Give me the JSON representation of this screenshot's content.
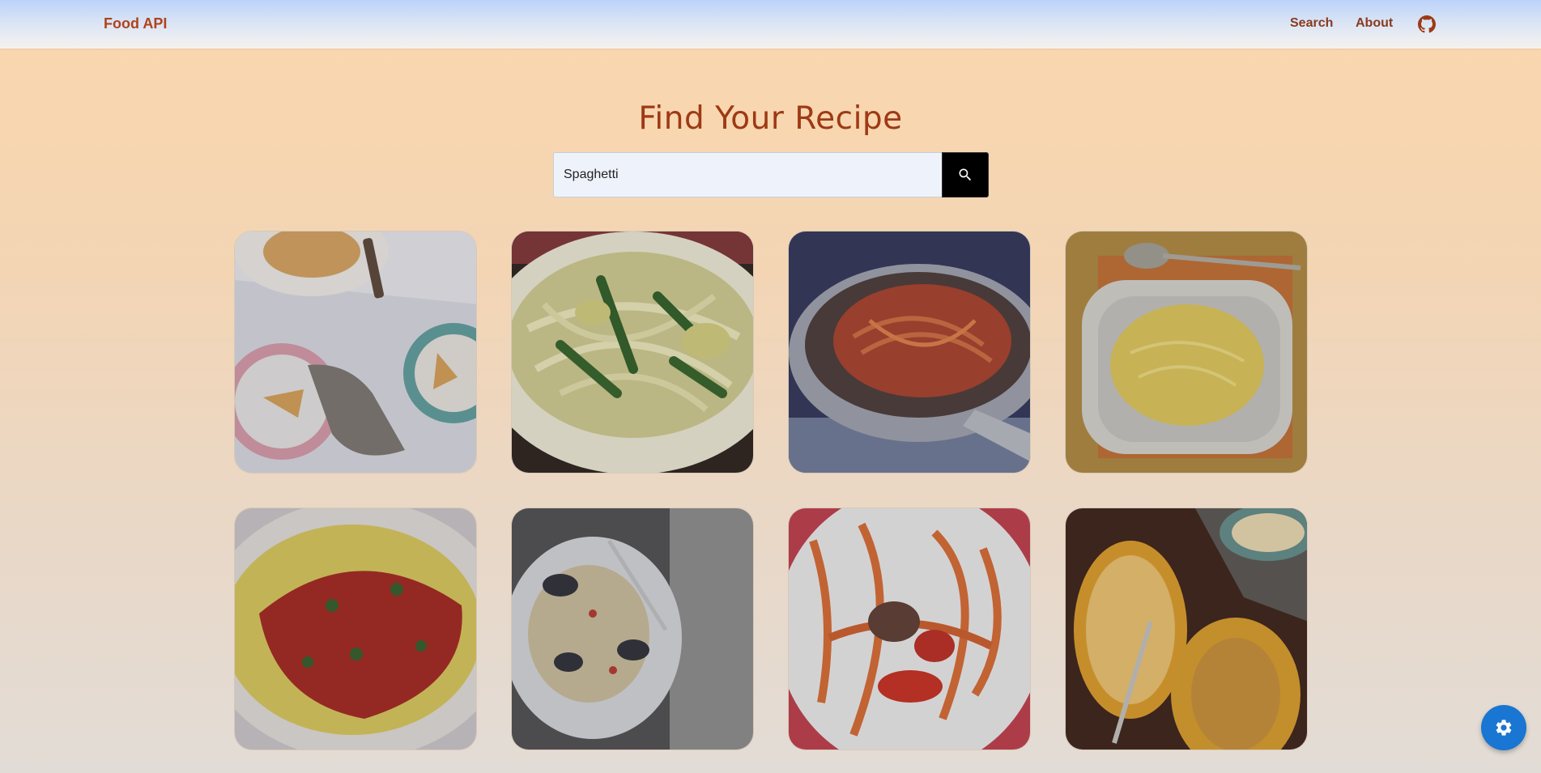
{
  "navbar": {
    "brand": "Food API",
    "links": [
      "Search",
      "About"
    ],
    "github_icon": "github-icon"
  },
  "hero": {
    "title": "Find Your Recipe"
  },
  "search": {
    "value": "Spaghetti",
    "button_icon": "search-icon"
  },
  "recipes": [
    {
      "name": "recipe-card-1",
      "image": "spaghetti pie slices on plates"
    },
    {
      "name": "recipe-card-2",
      "image": "spaghetti with green beans and potatoes"
    },
    {
      "name": "recipe-card-3",
      "image": "spaghetti with tomato sauce in pan"
    },
    {
      "name": "recipe-card-4",
      "image": "spaghetti squash in white bowl"
    },
    {
      "name": "recipe-card-5",
      "image": "spaghetti squash with tomato sauce"
    },
    {
      "name": "recipe-card-6",
      "image": "spaghetti with clams"
    },
    {
      "name": "recipe-card-7",
      "image": "bucatini with tomato and beef"
    },
    {
      "name": "recipe-card-8",
      "image": "roasted spaghetti squash halves"
    }
  ],
  "fab": {
    "icon": "gear-icon"
  },
  "colors": {
    "brand": "#b0431b",
    "title": "#9d3a15",
    "search_button": "#000000",
    "fab": "#1976d2"
  }
}
